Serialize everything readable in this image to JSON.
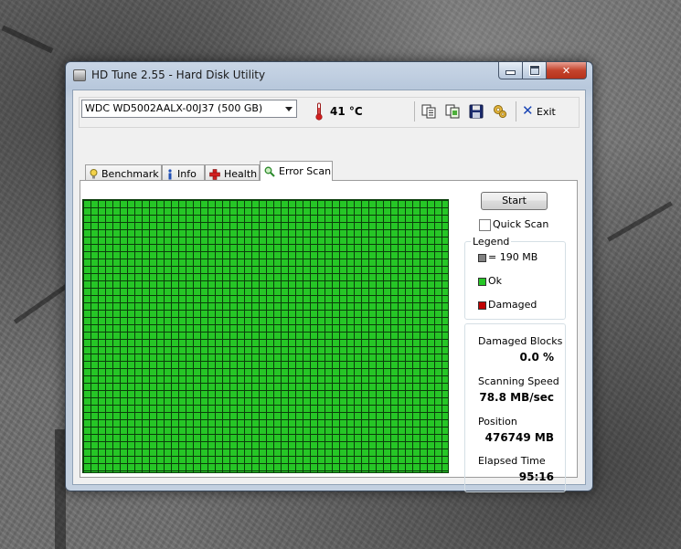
{
  "window": {
    "title": "HD Tune 2.55 - Hard Disk Utility"
  },
  "toolbar": {
    "drive": "WDC WD5002AALX-00J37 (500 GB)",
    "temperature": "41 °C",
    "exit_label": "Exit",
    "icons": [
      "copy-text-icon",
      "copy-screenshot-icon",
      "save-icon",
      "options-icon",
      "exit-icon"
    ]
  },
  "tabs": [
    {
      "label": "Benchmark",
      "icon": "benchmark-icon"
    },
    {
      "label": "Info",
      "icon": "info-icon"
    },
    {
      "label": "Health",
      "icon": "health-icon"
    },
    {
      "label": "Error Scan",
      "icon": "error-scan-icon",
      "active": true
    }
  ],
  "scan": {
    "start_label": "Start",
    "quick_scan_label": "Quick Scan",
    "quick_scan_checked": false,
    "block_status": "all-ok",
    "ok_color": "#26c626"
  },
  "legend": {
    "title": "Legend",
    "items": [
      {
        "label": "= 190 MB",
        "color": "#808080"
      },
      {
        "label": "Ok",
        "color": "#26c626"
      },
      {
        "label": "Damaged",
        "color": "#c00000"
      }
    ]
  },
  "stats": {
    "damaged_blocks_label": "Damaged Blocks",
    "damaged_blocks_value": "0.0 %",
    "scanning_speed_label": "Scanning Speed",
    "scanning_speed_value": "78.8 MB/sec",
    "position_label": "Position",
    "position_value": "476749 MB",
    "elapsed_label": "Elapsed Time",
    "elapsed_value": "95:16"
  }
}
